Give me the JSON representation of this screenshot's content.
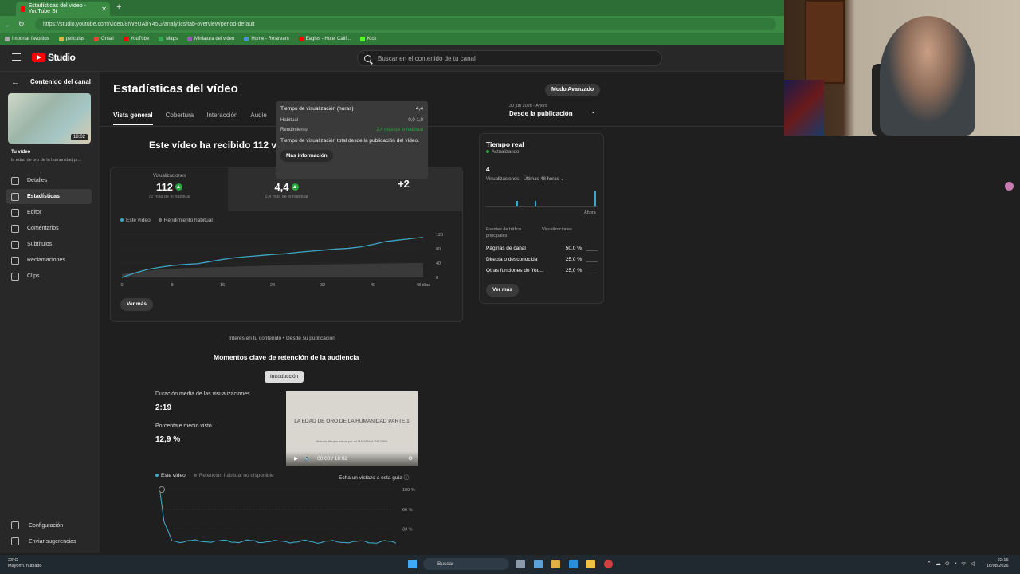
{
  "browser": {
    "tab_title": "Estadísticas del vídeo - YouTube St",
    "url": "https://studio.youtube.com/video/8IWeUAbY45G/analytics/tab-overview/period-default",
    "bookmarks": [
      "Importar favoritos",
      "peliculas",
      "Gmail",
      "YouTube",
      "Maps",
      "Miniatura del video",
      "Home - Restream",
      "Eagles - Hotel Calif...",
      "Kick"
    ]
  },
  "header": {
    "logo_text": "Studio",
    "search_placeholder": "Buscar en el contenido de tu canal"
  },
  "sidebar": {
    "back_title": "Contenido del canal",
    "thumb_duration": "18:02",
    "your_video": "Tu vídeo",
    "video_title": "la edad de oro de la humanidad pr...",
    "items": [
      {
        "label": "Detalles"
      },
      {
        "label": "Estadísticas"
      },
      {
        "label": "Editor"
      },
      {
        "label": "Comentarios"
      },
      {
        "label": "Subtítulos"
      },
      {
        "label": "Reclamaciones"
      },
      {
        "label": "Clips"
      }
    ],
    "settings": "Configuración",
    "feedback": "Enviar sugerencias"
  },
  "main": {
    "title": "Estadísticas del vídeo",
    "advanced_button": "Modo Avanzado",
    "tabs": [
      "Vista general",
      "Cobertura",
      "Interacción",
      "Audie"
    ],
    "date_small": "30 jun 2026 - Ahora",
    "date_big": "Desde la publicación",
    "headline": "Este vídeo ha recibido 112 vis",
    "metrics": [
      {
        "label": "Visualizaciones",
        "value": "112",
        "sub": "72 más de lo habitual"
      },
      {
        "label": "Tiempo de",
        "value": "4,4",
        "sub": "2,4 más de lo habitual"
      },
      {
        "label": "",
        "value": "+2",
        "sub": ""
      }
    ],
    "legend": [
      "Este vídeo",
      "Rendimiento habitual"
    ],
    "see_more": "Ver más"
  },
  "chart_data": {
    "type": "line",
    "x": [
      0,
      2,
      4,
      6,
      8,
      10,
      12,
      14,
      16,
      18,
      20,
      22,
      24,
      26,
      28,
      30,
      32,
      34,
      36,
      38,
      40,
      42,
      44,
      46,
      48
    ],
    "series": [
      {
        "name": "Este vídeo",
        "values": [
          0,
          12,
          22,
          28,
          33,
          36,
          38,
          44,
          50,
          55,
          58,
          61,
          64,
          66,
          70,
          73,
          76,
          79,
          81,
          85,
          92,
          100,
          104,
          108,
          112
        ]
      },
      {
        "name": "Rendimiento habitual",
        "values": [
          10,
          14,
          18,
          22,
          24,
          26,
          27,
          28,
          29,
          30,
          31,
          32,
          33,
          34,
          35,
          35,
          36,
          37,
          37,
          38,
          38,
          39,
          39,
          40,
          40
        ]
      }
    ],
    "xticks": [
      "0",
      "8",
      "16",
      "24",
      "32",
      "40",
      "48 días"
    ],
    "yticks": [
      "120",
      "80",
      "40",
      "0"
    ],
    "ylim": [
      0,
      120
    ]
  },
  "tooltip": {
    "title": "Tiempo de visualización (horas)",
    "title_value": "4,4",
    "typical_label": "Habitual",
    "typical_value": "0,0-1,0",
    "perf_label": "Rendimiento",
    "perf_value": "2,4 más de lo habitual",
    "description": "Tiempo de visualización total desde la publicación del vídeo.",
    "more_button": "Más información"
  },
  "realtime": {
    "title": "Tiempo real",
    "status": "Actualizando",
    "count": "4",
    "label": "Visualizaciones · Últimas 48 horas",
    "now": "Ahora",
    "col1": "Fuentes de tráfico principales",
    "col2": "Visualizaciones",
    "rows": [
      {
        "name": "Páginas de canal",
        "pct": "50,0 %"
      },
      {
        "name": "Directa o desconocida",
        "pct": "25,0 %"
      },
      {
        "name": "Otras funciones de You...",
        "pct": "25,0 %"
      }
    ],
    "see_more": "Ver más"
  },
  "retention": {
    "interest": "Interés en tu contenido • Desde su publicación",
    "title": "Momentos clave de retención de la audiencia",
    "chip": "Introducción",
    "avg_duration_label": "Duración media de las visualizaciones",
    "avg_duration": "2:19",
    "avg_pct_label": "Porcentaje medio visto",
    "avg_pct": "12,9 %",
    "player_title": "LA EDAD DE ORO DE LA HUMANIDAD PARTE 1",
    "player_sub": "Historia dibujos echos por mi MANZANA OSCURA",
    "player_time": "00:00 / 18:02",
    "legend_this": "Este vídeo",
    "legend_typical": "Retención habitual no disponible",
    "guide": "Echa un vistazo a esta guía",
    "yticks": [
      "100 %",
      "66 %",
      "33 %"
    ]
  },
  "taskbar": {
    "weather_temp": "23°C",
    "weather_desc": "Mayorm. nublado",
    "search": "Buscar",
    "time": "22:16",
    "date": "16/08/2026"
  }
}
